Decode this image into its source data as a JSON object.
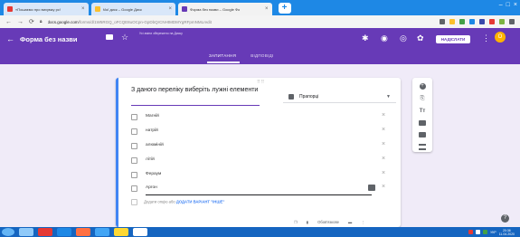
{
  "browser": {
    "tabs": [
      {
        "title": "«Пошаємо про вихумку рс!",
        "icon_color": "#e53935",
        "active": false
      },
      {
        "title": "Мої диск – Google Диск",
        "icon_color": "#fbc02d",
        "active": false
      },
      {
        "title": "Форма без назви – Google Фо",
        "icon_color": "#673ab7",
        "active": true
      }
    ],
    "new_tab": "+",
    "url": "docs.google.com",
    "url_rest": "/forms/d/1W5RGQ_oFCQE8uOCpn-GpDbQrCNHtMDMYgRFpmNMLredit",
    "ext_colors": [
      "#5f6368",
      "#fbc02d",
      "#43a047",
      "#1e88e5",
      "#3949ab",
      "#e53935",
      "#7cb342",
      "#5f6368"
    ]
  },
  "forms_header": {
    "back_icon": "arrow-back-icon",
    "title": "Форма без назви",
    "saved_text": "Усі зміни збережено на Диску",
    "send_label": "НАДІСЛАТИ",
    "avatar_letter": "О",
    "tabs": [
      {
        "label": "ЗАПИТАННЯ",
        "active": true
      },
      {
        "label": "ВІДПОВІДІ",
        "active": false
      }
    ]
  },
  "question": {
    "title": "З даного переліку виберіть лужні елементи",
    "type": "Прапорці",
    "options": [
      "Магній",
      "натрій",
      "алюміній",
      "літій",
      "Фераум",
      "Аргон"
    ],
    "add_option": "Додати опцію",
    "add_other_prefix": "або",
    "add_other": "ДОДАТИ ВАРІАНТ \"ІНШЕ\"",
    "footer_label": "Обов'язкове"
  },
  "taskbar": {
    "items": [
      "#90caf9",
      "#e53935",
      "#1e88e5",
      "#ff7043",
      "#42a5f5",
      "#fdd835",
      "#ffffff"
    ],
    "lang": "УКР",
    "time": "20:36",
    "date": "11.04.2020"
  }
}
